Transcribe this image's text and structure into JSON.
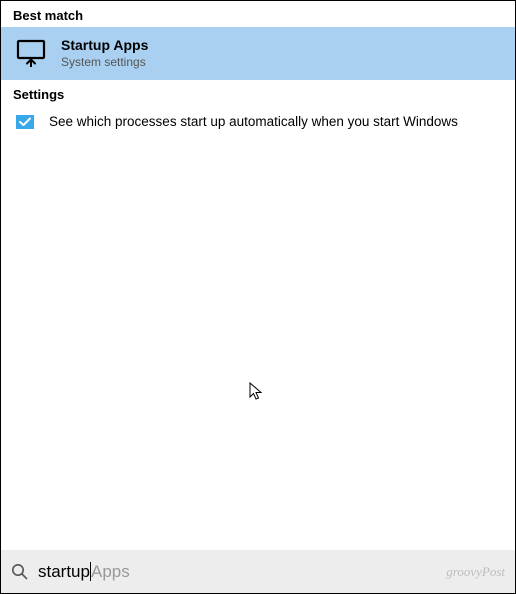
{
  "sections": {
    "best_match_header": "Best match",
    "settings_header": "Settings"
  },
  "best_match": {
    "title": "Startup Apps",
    "subtitle": "System settings"
  },
  "settings_results": [
    {
      "text": "See which processes start up automatically when you start Windows"
    }
  ],
  "search": {
    "typed": "startup",
    "suggestion": "Apps"
  },
  "watermark": "groovyPost"
}
